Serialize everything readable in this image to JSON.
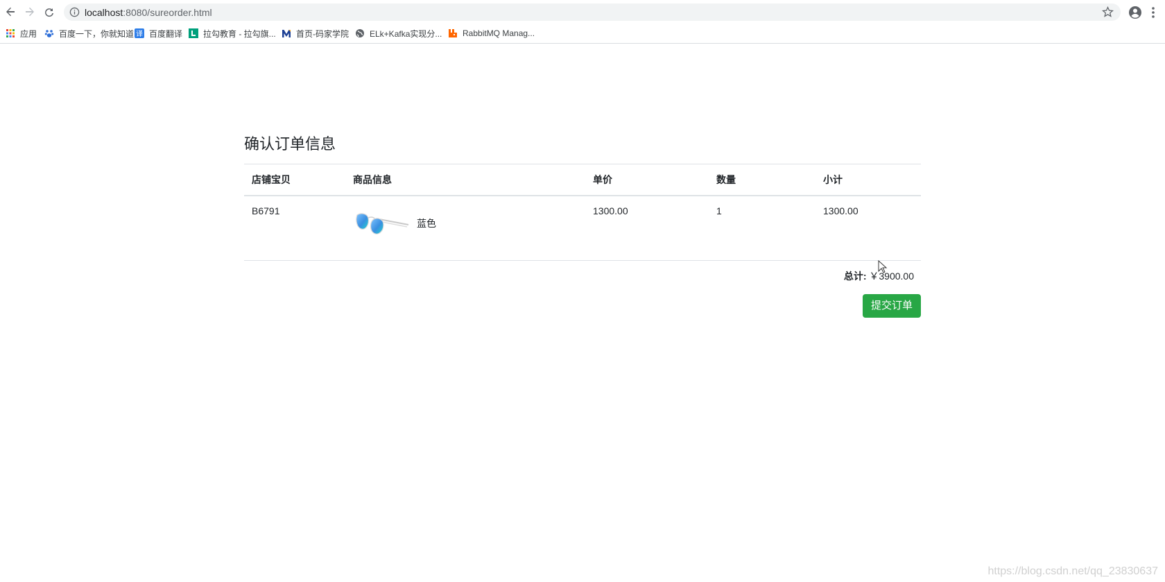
{
  "browser": {
    "url_host": "localhost",
    "url_path": ":8080/sureorder.html",
    "bookmarks": [
      {
        "label": "应用",
        "icon": "apps-grid-icon"
      },
      {
        "label": "百度一下，你就知道",
        "icon": "baidu-paw-icon"
      },
      {
        "label": "百度翻译",
        "icon": "translate-icon"
      },
      {
        "label": "拉勾教育 - 拉勾旗...",
        "icon": "lagou-icon"
      },
      {
        "label": "首页-码家学院",
        "icon": "m-logo-icon"
      },
      {
        "label": "ELk+Kafka实现分...",
        "icon": "globe-icon"
      },
      {
        "label": "RabbitMQ Manag...",
        "icon": "rabbitmq-icon"
      }
    ]
  },
  "page": {
    "title": "确认订单信息",
    "table": {
      "headers": [
        "店铺宝贝",
        "商品信息",
        "单价",
        "数量",
        "小计"
      ],
      "rows": [
        {
          "sku": "B6791",
          "product": "蓝色",
          "price": "1300.00",
          "qty": "1",
          "subtotal": "1300.00"
        }
      ]
    },
    "total_label": "总计:",
    "total_value": "￥3900.00",
    "submit_label": "提交订单"
  },
  "watermark": "https://blog.csdn.net/qq_23830637",
  "colors": {
    "accent": "#28a745"
  }
}
